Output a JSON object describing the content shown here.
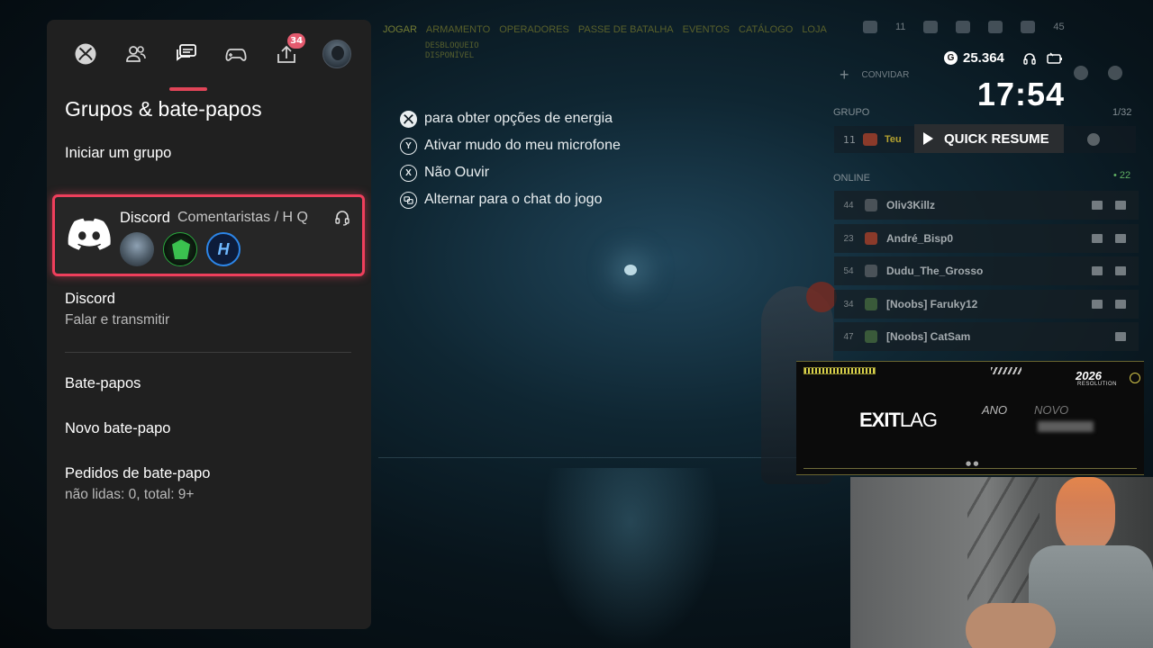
{
  "game": {
    "top_menu": [
      "JOGAR",
      "ARMAMENTO",
      "OPERADORES",
      "PASSE DE BATALHA",
      "EVENTOS",
      "CATÁLOGO",
      "LOJA"
    ],
    "unlock_text": [
      "DESBLOQUEIO",
      "DISPONÍVEL"
    ],
    "hud_values": [
      "11",
      "45"
    ],
    "invite_label": "CONVIDAR",
    "group_label": "GRUPO",
    "group_count": "1/32",
    "group_member": {
      "level": "11",
      "name": "Teu"
    },
    "online_label": "ONLINE",
    "online_count": "22",
    "online_players": [
      {
        "level": "44",
        "name": "Oliv3Killz"
      },
      {
        "level": "23",
        "name": "André_Bisp0"
      },
      {
        "level": "54",
        "name": "Dudu_The_Grosso"
      },
      {
        "level": "34",
        "name": "[Noobs] Faruky12"
      },
      {
        "level": "47",
        "name": "[Noobs] CatSam"
      }
    ]
  },
  "status": {
    "gamerscore": "25.364",
    "gamerscore_icon": "G",
    "clock": "17:54"
  },
  "quick_resume": {
    "label": "QUICK RESUME"
  },
  "guide": {
    "tabs": [
      {
        "name": "xbox-home",
        "icon": "xbox-icon"
      },
      {
        "name": "people",
        "icon": "people-icon"
      },
      {
        "name": "parties-chats",
        "icon": "chat-icon",
        "active": true
      },
      {
        "name": "games",
        "icon": "controller-icon"
      },
      {
        "name": "uploads",
        "icon": "upload-icon",
        "badge": "34"
      },
      {
        "name": "profile",
        "icon": "avatar"
      }
    ],
    "title": "Grupos & bate-papos",
    "start_party": "Iniciar um grupo",
    "discord_card": {
      "service": "Discord",
      "channel": "Comentaristas / H Q",
      "members": [
        "member-1",
        "member-2",
        "member-3"
      ],
      "member3_initial": "H"
    },
    "discord_item": {
      "title": "Discord",
      "subtitle": "Falar e transmitir"
    },
    "chats": "Bate-papos",
    "new_chat": "Novo bate-papo",
    "chat_requests": {
      "title": "Pedidos de bate-papo",
      "subtitle": "não lidas: 0, total: 9+"
    }
  },
  "hints": [
    {
      "button": "xbox",
      "text": "para obter opções de energia"
    },
    {
      "button": "Y",
      "text": "Ativar mudo do meu microfone"
    },
    {
      "button": "X",
      "text": "Não Ouvir"
    },
    {
      "button": "view",
      "text": "Alternar para o chat do jogo"
    }
  ],
  "banner": {
    "logo_bold": "EXIT",
    "logo_light": "LAG",
    "ano": "ANO",
    "novo": "NOVO",
    "year": "2026",
    "subtitle": "RESOLUTION"
  },
  "colors": {
    "accent_pink": "#ef3f5c",
    "badge": "#e45a6e",
    "panel_bg": "#202020",
    "discord_blue": "#ffffff"
  }
}
